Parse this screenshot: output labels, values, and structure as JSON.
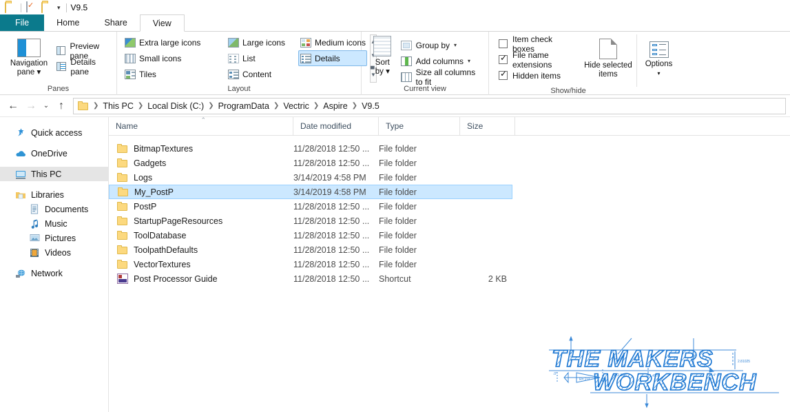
{
  "titlebar": {
    "title": "V9.5",
    "icons": [
      "folder-icon",
      "properties-checkbox-icon",
      "new-folder-icon",
      "customize-quick-access-caret"
    ]
  },
  "tabs": [
    {
      "label": "File",
      "kind": "file"
    },
    {
      "label": "Home",
      "kind": "normal"
    },
    {
      "label": "Share",
      "kind": "normal"
    },
    {
      "label": "View",
      "kind": "active"
    }
  ],
  "ribbon": {
    "panes": {
      "group_label": "Panes",
      "navigation_pane": "Navigation\npane",
      "navigation_pane_line1": "Navigation",
      "navigation_pane_line2": "pane",
      "preview_pane": "Preview pane",
      "details_pane": "Details pane"
    },
    "layout": {
      "group_label": "Layout",
      "items": [
        {
          "label": "Extra large icons",
          "selected": false
        },
        {
          "label": "Large icons",
          "selected": false
        },
        {
          "label": "Medium icons",
          "selected": false
        },
        {
          "label": "Small icons",
          "selected": false
        },
        {
          "label": "List",
          "selected": false
        },
        {
          "label": "Details",
          "selected": true
        },
        {
          "label": "Tiles",
          "selected": false
        },
        {
          "label": "Content",
          "selected": false
        }
      ]
    },
    "current_view": {
      "group_label": "Current view",
      "sort_by_line1": "Sort",
      "sort_by_line2": "by",
      "group_by": "Group by",
      "add_columns": "Add columns",
      "size_all_columns": "Size all columns to fit"
    },
    "show_hide": {
      "group_label": "Show/hide",
      "item_check_boxes": {
        "label": "Item check boxes",
        "checked": false
      },
      "file_name_extensions": {
        "label": "File name extensions",
        "checked": true
      },
      "hidden_items": {
        "label": "Hidden items",
        "checked": true
      },
      "hide_selected_line1": "Hide selected",
      "hide_selected_line2": "items",
      "options": "Options"
    }
  },
  "addressbar": {
    "back": "←",
    "forward": "→",
    "recent": "⌄",
    "up": "↑",
    "breadcrumbs": [
      "This PC",
      "Local Disk (C:)",
      "ProgramData",
      "Vectric",
      "Aspire",
      "V9.5"
    ]
  },
  "sidebar": {
    "items": [
      {
        "label": "Quick access",
        "icon": "pin-star-icon",
        "glyph": "📌",
        "selected": false,
        "indent": false
      },
      {
        "label": "OneDrive",
        "icon": "cloud-icon",
        "glyph": "☁",
        "selected": false,
        "indent": false
      },
      {
        "label": "This PC",
        "icon": "monitor-icon",
        "glyph": "🖥",
        "selected": true,
        "indent": false
      },
      {
        "label": "Libraries",
        "icon": "libraries-folder-icon",
        "glyph": "🗂",
        "selected": false,
        "indent": false
      },
      {
        "label": "Documents",
        "icon": "documents-icon",
        "glyph": "📄",
        "selected": false,
        "indent": true
      },
      {
        "label": "Music",
        "icon": "music-note-icon",
        "glyph": "♪",
        "selected": false,
        "indent": true
      },
      {
        "label": "Pictures",
        "icon": "pictures-icon",
        "glyph": "🖼",
        "selected": false,
        "indent": true
      },
      {
        "label": "Videos",
        "icon": "videos-icon",
        "glyph": "🎞",
        "selected": false,
        "indent": true
      },
      {
        "label": "Network",
        "icon": "network-icon",
        "glyph": "🖧",
        "selected": false,
        "indent": false
      }
    ]
  },
  "filelist": {
    "columns": [
      {
        "label": "Name",
        "sorted": "asc"
      },
      {
        "label": "Date modified",
        "sorted": ""
      },
      {
        "label": "Type",
        "sorted": ""
      },
      {
        "label": "Size",
        "sorted": ""
      }
    ],
    "rows": [
      {
        "name": "BitmapTextures",
        "date": "11/28/2018 12:50 ...",
        "type": "File folder",
        "size": "",
        "icon": "folder-icon",
        "selected": false
      },
      {
        "name": "Gadgets",
        "date": "11/28/2018 12:50 ...",
        "type": "File folder",
        "size": "",
        "icon": "folder-icon",
        "selected": false
      },
      {
        "name": "Logs",
        "date": "3/14/2019 4:58 PM",
        "type": "File folder",
        "size": "",
        "icon": "folder-icon",
        "selected": false
      },
      {
        "name": "My_PostP",
        "date": "3/14/2019 4:58 PM",
        "type": "File folder",
        "size": "",
        "icon": "folder-icon",
        "selected": true
      },
      {
        "name": "PostP",
        "date": "11/28/2018 12:50 ...",
        "type": "File folder",
        "size": "",
        "icon": "folder-icon",
        "selected": false
      },
      {
        "name": "StartupPageResources",
        "date": "11/28/2018 12:50 ...",
        "type": "File folder",
        "size": "",
        "icon": "folder-icon",
        "selected": false
      },
      {
        "name": "ToolDatabase",
        "date": "11/28/2018 12:50 ...",
        "type": "File folder",
        "size": "",
        "icon": "folder-icon",
        "selected": false
      },
      {
        "name": "ToolpathDefaults",
        "date": "11/28/2018 12:50 ...",
        "type": "File folder",
        "size": "",
        "icon": "folder-icon",
        "selected": false
      },
      {
        "name": "VectorTextures",
        "date": "11/28/2018 12:50 ...",
        "type": "File folder",
        "size": "",
        "icon": "folder-icon",
        "selected": false
      },
      {
        "name": "Post Processor Guide",
        "date": "11/28/2018 12:50 ...",
        "type": "Shortcut",
        "size": "2 KB",
        "icon": "pdf-shortcut-icon",
        "selected": false
      }
    ]
  },
  "watermark": {
    "line1": "THE MAKERS",
    "line2": "WORKBENCH",
    "annotations": [
      "2.81025",
      "Ø 2.88U",
      "1.4570",
      "R .4°",
      ".0°",
      "R= 2.0"
    ],
    "color": "#1b76d2"
  },
  "colors": {
    "accent_file_tab": "#0b7a8c",
    "selection_fill": "#cce8ff",
    "selection_border": "#99d1ff",
    "sidebar_selected": "#e5e5e5",
    "folder_yellow": "#fcd97f",
    "watermark_blue": "#1b76d2"
  }
}
